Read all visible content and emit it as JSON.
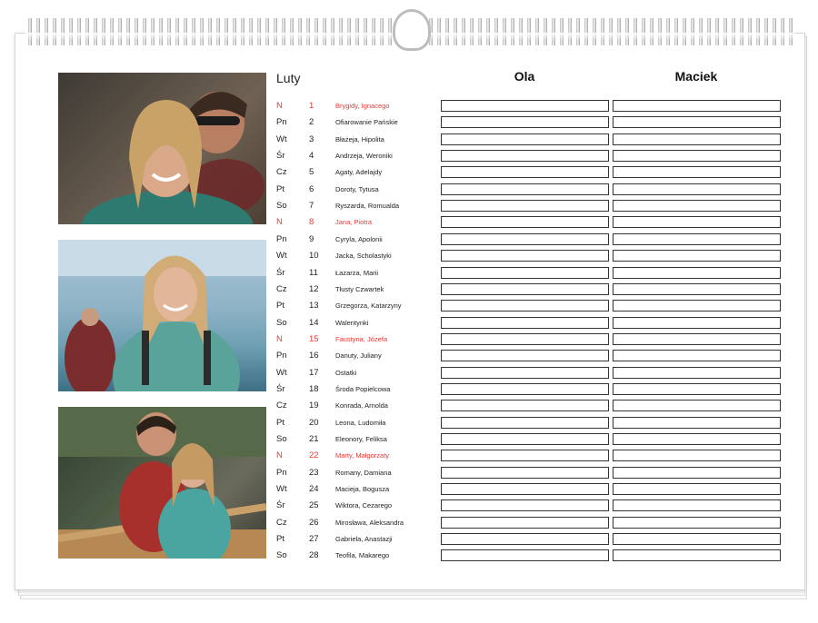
{
  "calendar": {
    "month": "Luty",
    "columns": [
      "Ola",
      "Maciek"
    ],
    "accent_color": "#e53935",
    "photos": [
      "couple-selfie-photo",
      "hiker-woman-photo",
      "couple-on-bridge-photo"
    ],
    "days": [
      {
        "weekday": "N",
        "day": "1",
        "names": "Brygidy, Ignacego",
        "sunday": true
      },
      {
        "weekday": "Pn",
        "day": "2",
        "names": "Ofiarowanie Pańskie",
        "sunday": false
      },
      {
        "weekday": "Wt",
        "day": "3",
        "names": "Błażeja, Hipolita",
        "sunday": false
      },
      {
        "weekday": "Śr",
        "day": "4",
        "names": "Andrzeja, Weroniki",
        "sunday": false
      },
      {
        "weekday": "Cz",
        "day": "5",
        "names": "Agaty, Adelajdy",
        "sunday": false
      },
      {
        "weekday": "Pt",
        "day": "6",
        "names": "Doroty, Tytusa",
        "sunday": false
      },
      {
        "weekday": "So",
        "day": "7",
        "names": "Ryszarda, Romualda",
        "sunday": false
      },
      {
        "weekday": "N",
        "day": "8",
        "names": "Jana, Piotra",
        "sunday": true
      },
      {
        "weekday": "Pn",
        "day": "9",
        "names": "Cyryla, Apolonii",
        "sunday": false
      },
      {
        "weekday": "Wt",
        "day": "10",
        "names": "Jacka, Scholastyki",
        "sunday": false
      },
      {
        "weekday": "Śr",
        "day": "11",
        "names": "Łazarza, Marii",
        "sunday": false
      },
      {
        "weekday": "Cz",
        "day": "12",
        "names": "Tłusty Czwartek",
        "sunday": false
      },
      {
        "weekday": "Pt",
        "day": "13",
        "names": "Grzegorza, Katarzyny",
        "sunday": false
      },
      {
        "weekday": "So",
        "day": "14",
        "names": "Walentynki",
        "sunday": false
      },
      {
        "weekday": "N",
        "day": "15",
        "names": "Faustyna, Józefa",
        "sunday": true
      },
      {
        "weekday": "Pn",
        "day": "16",
        "names": "Danuty, Juliany",
        "sunday": false
      },
      {
        "weekday": "Wt",
        "day": "17",
        "names": "Ostatki",
        "sunday": false
      },
      {
        "weekday": "Śr",
        "day": "18",
        "names": "Środa Popielcowa",
        "sunday": false
      },
      {
        "weekday": "Cz",
        "day": "19",
        "names": "Konrada, Arnolda",
        "sunday": false
      },
      {
        "weekday": "Pt",
        "day": "20",
        "names": "Leona, Ludomiła",
        "sunday": false
      },
      {
        "weekday": "So",
        "day": "21",
        "names": "Eleonory, Feliksa",
        "sunday": false
      },
      {
        "weekday": "N",
        "day": "22",
        "names": "Marty, Małgorzaty",
        "sunday": true
      },
      {
        "weekday": "Pn",
        "day": "23",
        "names": "Romany, Damiana",
        "sunday": false
      },
      {
        "weekday": "Wt",
        "day": "24",
        "names": "Macieja, Bogusza",
        "sunday": false
      },
      {
        "weekday": "Śr",
        "day": "25",
        "names": "Wiktora, Cezarego",
        "sunday": false
      },
      {
        "weekday": "Cz",
        "day": "26",
        "names": "Mirosława, Aleksandra",
        "sunday": false
      },
      {
        "weekday": "Pt",
        "day": "27",
        "names": "Gabriela, Anastazji",
        "sunday": false
      },
      {
        "weekday": "So",
        "day": "28",
        "names": "Teofila, Makarego",
        "sunday": false
      }
    ]
  }
}
